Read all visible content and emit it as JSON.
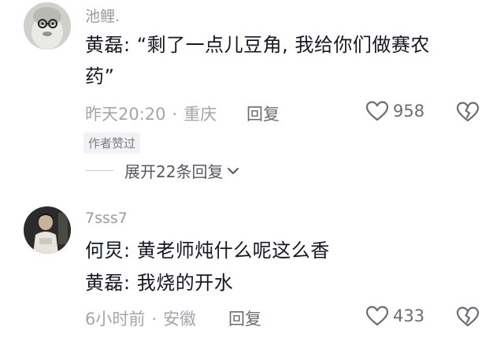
{
  "comments": [
    {
      "username": "池鲤.",
      "lines": [
        "黄磊: “剩了一点儿豆角, 我给你们做赛农",
        "药”"
      ],
      "time": "昨天20:20",
      "location": "重庆",
      "reply_label": "回复",
      "likes": "958",
      "badge": "作者赞过",
      "expand_label": "展开22条回复"
    },
    {
      "username": "7sss7",
      "lines": [
        "何炅: 黄老师炖什么呢这么香",
        "黄磊: 我烧的开水"
      ],
      "time": "6小时前",
      "location": "安徽",
      "reply_label": "回复",
      "likes": "433"
    }
  ],
  "icons": {
    "like": "heart-outline-icon",
    "dislike": "broken-heart-icon",
    "expand": "chevron-down-icon"
  },
  "colors": {
    "text": "#161823",
    "meta": "#a3a5ab",
    "secondary": "#6a6c73"
  }
}
